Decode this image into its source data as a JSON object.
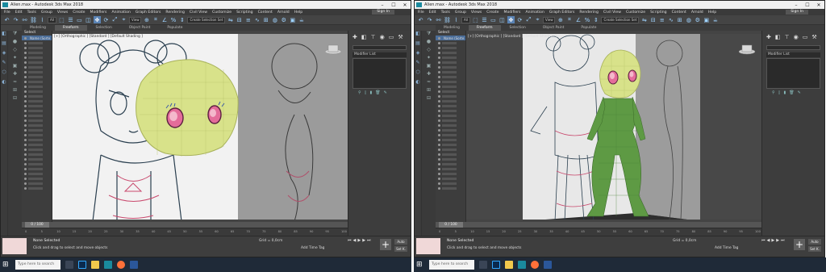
{
  "windows": [
    {
      "title": "Alien.max - Autodesk 3ds Max 2018",
      "viewport_label": "[+] [Orthographic ] [Standard ] [Default Shading ]"
    },
    {
      "title": "Alien.max - Autodesk 3ds Max 2018",
      "viewport_label": "[+] [Orthographic ] [Standard ] [Default Shading ]"
    }
  ],
  "menu": [
    "File",
    "Edit",
    "Tools",
    "Group",
    "Views",
    "Create",
    "Modifiers",
    "Animation",
    "Graph Editors",
    "Rendering",
    "Civil View",
    "Customize",
    "Scripting",
    "Content",
    "Arnold",
    "Help"
  ],
  "signin_label": "Sign In",
  "toolbar": {
    "filter_value": "All",
    "view_value": "View",
    "selection_set": "Create Selection Set"
  },
  "ribbon_tabs": [
    "Modeling",
    "Freeform",
    "Selection",
    "Object Paint",
    "Populate"
  ],
  "active_ribbon": "Freeform",
  "scene_explorer": {
    "header": "Select",
    "col_label": "Name (Sorte"
  },
  "command_panel": {
    "modifier_list": "Modifier List"
  },
  "time_slider": {
    "label": "0 / 100"
  },
  "track_ticks": [
    "0",
    "5",
    "10",
    "15",
    "20",
    "25",
    "30",
    "35",
    "40",
    "45",
    "50",
    "55",
    "60",
    "65",
    "70",
    "75",
    "80",
    "85",
    "90",
    "95",
    "100"
  ],
  "status": {
    "selection": "None Selected",
    "prompt": "Click and drag to select and move objects",
    "grid": "Grid = 0,0cm",
    "add_time_tag": "Add Time Tag",
    "auto_key": "Auto",
    "set_key": "Set K."
  },
  "taskbar": {
    "search_placeholder": "Type here to search"
  },
  "colors": {
    "ui_dark": "#444444",
    "head_green": "#d8e28a",
    "body_green": "#5e9a44",
    "eye_pink": "#e46c9a",
    "accent_blue": "#5a83b4"
  }
}
